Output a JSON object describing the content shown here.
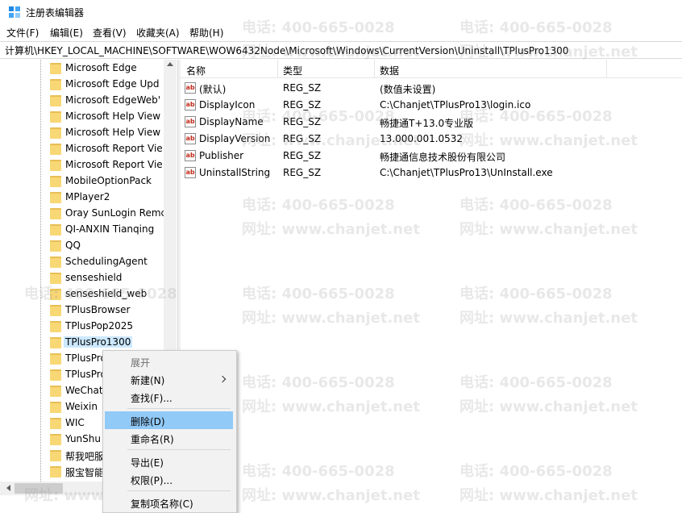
{
  "window": {
    "title": "注册表编辑器"
  },
  "menu": [
    "文件(F)",
    "编辑(E)",
    "查看(V)",
    "收藏夹(A)",
    "帮助(H)"
  ],
  "address": "计算机\\HKEY_LOCAL_MACHINE\\SOFTWARE\\WOW6432Node\\Microsoft\\Windows\\CurrentVersion\\Uninstall\\TPlusPro1300",
  "tree": {
    "items": [
      "Microsoft Edge",
      "Microsoft Edge Upd",
      "Microsoft EdgeWeb'",
      "Microsoft Help View",
      "Microsoft Help View",
      "Microsoft Report Vie",
      "Microsoft Report Vie",
      "MobileOptionPack",
      "MPlayer2",
      "Oray SunLogin Remc",
      "QI-ANXIN Tianqing",
      "QQ",
      "SchedulingAgent",
      "senseshield",
      "senseshield_web",
      "TPlusBrowser",
      "TPlusPop2025",
      "TPlusPro1300",
      "TPlusPro",
      "TPlusPro",
      "WeChat",
      "Weixin",
      "WIC",
      "YunShu",
      "帮我吧服",
      "服宝智能"
    ],
    "selected": "TPlusPro1300"
  },
  "list": {
    "headers": {
      "name": "名称",
      "type": "类型",
      "data": "数据"
    },
    "rows": [
      {
        "name": "(默认)",
        "type": "REG_SZ",
        "data": "(数值未设置)"
      },
      {
        "name": "DisplayIcon",
        "type": "REG_SZ",
        "data": "C:\\Chanjet\\TPlusPro13\\login.ico"
      },
      {
        "name": "DisplayName",
        "type": "REG_SZ",
        "data": "畅捷通T+13.0专业版"
      },
      {
        "name": "DisplayVersion",
        "type": "REG_SZ",
        "data": "13.000.001.0532"
      },
      {
        "name": "Publisher",
        "type": "REG_SZ",
        "data": "畅捷通信息技术股份有限公司"
      },
      {
        "name": "UninstallString",
        "type": "REG_SZ",
        "data": "C:\\Chanjet\\TPlusPro13\\UnInstall.exe"
      }
    ],
    "icon_glyph": "ab"
  },
  "context_menu": {
    "items": [
      "展开",
      "新建(N)",
      "查找(F)...",
      "删除(D)",
      "重命名(R)",
      "导出(E)",
      "权限(P)...",
      "复制项名称(C)"
    ],
    "hovered": "删除(D)"
  },
  "watermarks": {
    "phone": "电话: 400-665-0028",
    "site": "网址: www.chanjet.net"
  },
  "colors": {
    "selection": "#cce8ff",
    "menu_hover": "#91c9f7",
    "folder": "#f8d775"
  }
}
